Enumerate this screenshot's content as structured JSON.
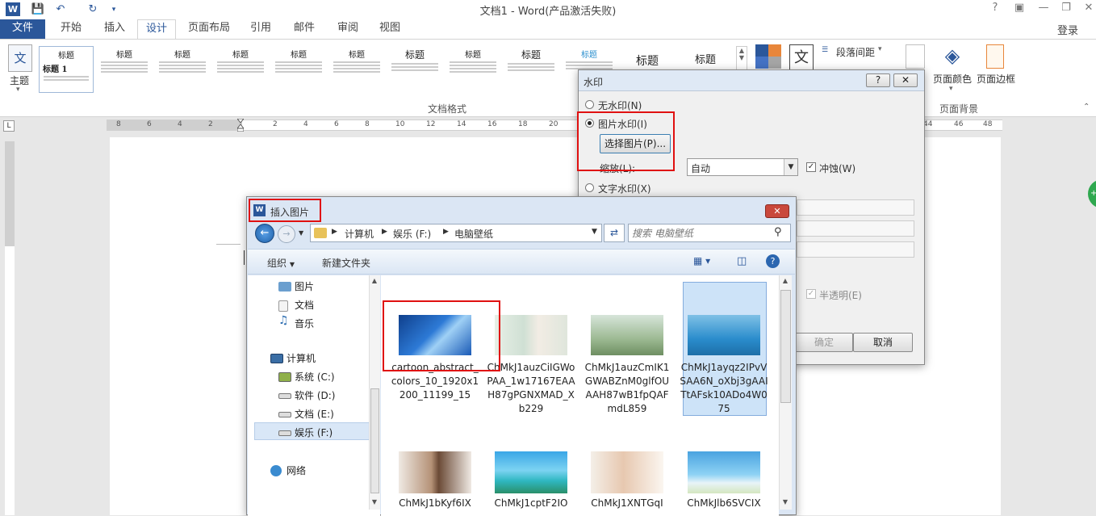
{
  "window": {
    "title": "文档1 - Word(产品激活失败)",
    "help": "?",
    "login": "登录"
  },
  "tabs": [
    "文件",
    "开始",
    "插入",
    "设计",
    "页面布局",
    "引用",
    "邮件",
    "审阅",
    "视图"
  ],
  "ribbon": {
    "theme_label": "主题",
    "style_heading": "标题",
    "style_heading1": "标题 1",
    "doc_format_label": "文档格式",
    "paragraph_spacing": "段落间距",
    "page_color": "页面颜色",
    "page_border": "页面边框",
    "page_background": "页面背景"
  },
  "ruler": {
    "ticks": [
      "8",
      "6",
      "4",
      "2",
      "2",
      "4",
      "6",
      "8",
      "10",
      "12",
      "14",
      "16",
      "18",
      "20",
      "44",
      "46",
      "48"
    ]
  },
  "watermark_dialog": {
    "title": "水印",
    "help": "?",
    "no_watermark": "无水印(N)",
    "picture_watermark": "图片水印(I)",
    "select_picture": "选择图片(P)...",
    "scale_label": "缩放(L):",
    "scale_value": "自动",
    "washout": "冲蚀(W)",
    "text_watermark": "文字水印(X)",
    "semitransparent": "半透明(E)",
    "ok": "确定",
    "cancel": "取消"
  },
  "insert_picture_dialog": {
    "title": "插入图片",
    "breadcrumb": [
      "计算机",
      "娱乐 (F:)",
      "电脑壁纸"
    ],
    "search_placeholder": "搜索 电脑壁纸",
    "organize": "组织",
    "new_folder": "新建文件夹",
    "tree": {
      "pictures": "图片",
      "documents": "文档",
      "music": "音乐",
      "computer": "计算机",
      "drive_c": "系统 (C:)",
      "drive_d": "软件 (D:)",
      "drive_e": "文档 (E:)",
      "drive_f": "娱乐 (F:)",
      "network": "网络"
    },
    "files_row1": [
      "cartoon_abstract_colors_10_1920x1200_11199_15",
      "ChMkJ1auzCiIGWoPAA_1w17167EAAH87gPGNXMAD_Xb229",
      "ChMkJ1auzCmIK1GWABZnM0glfOUAAH87wB1fpQAFmdL859",
      "ChMkJ1ayqz2IPvVSAA6N_oXbj3gAAITtAFsk10ADo4W075"
    ],
    "files_row2": [
      "ChMkJ1bKyf6IX",
      "ChMkJ1cptF2IO",
      "ChMkJ1XNTGqI",
      "ChMkJlb6SVCIX"
    ]
  }
}
